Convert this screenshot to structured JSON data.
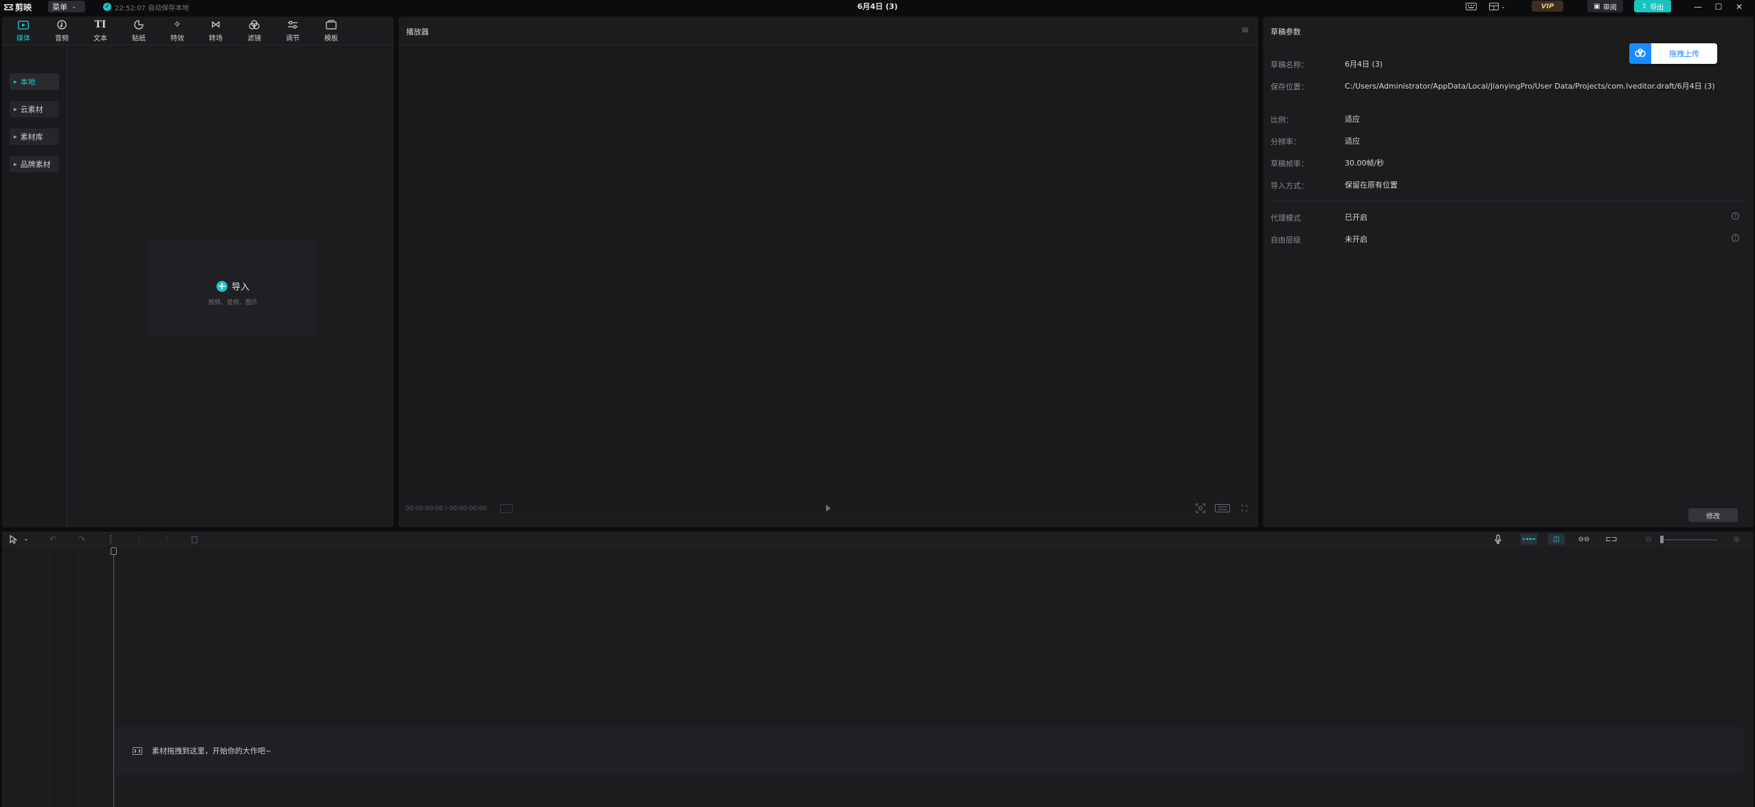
{
  "app": {
    "logo_text": "剪映",
    "menu_label": "菜单",
    "autosave_text": "22:52:07 自动保存本地",
    "window_title": "6月4日 (3)",
    "vip_label": "VIP",
    "review_label": "审阅",
    "export_label": "导出",
    "accent_color": "#1bc3c0"
  },
  "media": {
    "tabs": [
      {
        "label": "媒体",
        "icon": "media-icon"
      },
      {
        "label": "音频",
        "icon": "audio-icon"
      },
      {
        "label": "文本",
        "icon": "text-icon"
      },
      {
        "label": "贴纸",
        "icon": "sticker-icon"
      },
      {
        "label": "特效",
        "icon": "effects-icon"
      },
      {
        "label": "转场",
        "icon": "transition-icon"
      },
      {
        "label": "滤镜",
        "icon": "filter-icon"
      },
      {
        "label": "调节",
        "icon": "adjust-icon"
      },
      {
        "label": "模板",
        "icon": "template-icon"
      }
    ],
    "sidebar": [
      {
        "label": "本地"
      },
      {
        "label": "云素材"
      },
      {
        "label": "素材库"
      },
      {
        "label": "品牌素材"
      }
    ],
    "import_label": "导入",
    "import_sub": "视频、音频、图片"
  },
  "player": {
    "title": "播放器",
    "time": "00:00:00:00 / 00:00:00:00"
  },
  "draft": {
    "title": "草稿参数",
    "upload_label": "拖拽上传",
    "rows": [
      {
        "key": "草稿名称：",
        "value": "6月4日 (3)"
      },
      {
        "key": "保存位置：",
        "value": "C:/Users/Administrator/AppData/Local/JianyingPro/User Data/Projects/com.lveditor.draft/6月4日 (3)"
      },
      {
        "key": "比例：",
        "value": "适应"
      },
      {
        "key": "分辨率：",
        "value": "适应"
      },
      {
        "key": "草稿帧率：",
        "value": "30.00帧/秒"
      },
      {
        "key": "导入方式：",
        "value": "保留在原有位置"
      }
    ],
    "settings": [
      {
        "key": "代理模式",
        "value": "已开启"
      },
      {
        "key": "自由层级",
        "value": "未开启"
      }
    ],
    "modify_label": "修改"
  },
  "timeline": {
    "drop_hint": "素材拖拽到这里，开始你的大作吧~"
  }
}
